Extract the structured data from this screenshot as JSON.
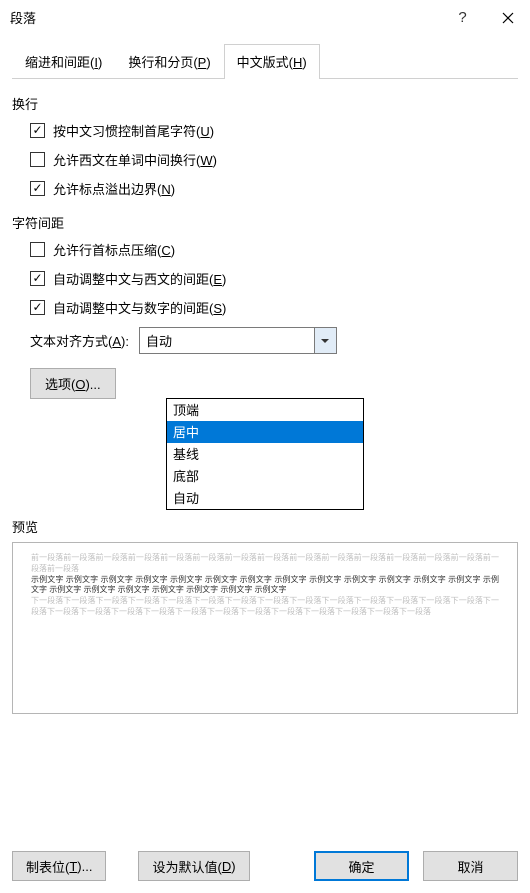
{
  "title": "段落",
  "tabs": {
    "t0": {
      "pre": "缩进和间距(",
      "key": "I",
      "post": ")"
    },
    "t1": {
      "pre": "换行和分页(",
      "key": "P",
      "post": ")"
    },
    "t2": {
      "pre": "中文版式(",
      "key": "H",
      "post": ")"
    }
  },
  "group1": {
    "label": "换行",
    "c0": {
      "pre": "按中文习惯控制首尾字符(",
      "key": "U",
      "post": ")",
      "checked": true
    },
    "c1": {
      "pre": "允许西文在单词中间换行(",
      "key": "W",
      "post": ")",
      "checked": false
    },
    "c2": {
      "pre": "允许标点溢出边界(",
      "key": "N",
      "post": ")",
      "checked": true
    }
  },
  "group2": {
    "label": "字符间距",
    "c0": {
      "pre": "允许行首标点压缩(",
      "key": "C",
      "post": ")",
      "checked": false
    },
    "c1": {
      "pre": "自动调整中文与西文的间距(",
      "key": "E",
      "post": ")",
      "checked": true
    },
    "c2": {
      "pre": "自动调整中文与数字的间距(",
      "key": "S",
      "post": ")",
      "checked": true
    }
  },
  "align": {
    "label_pre": "文本对齐方式(",
    "label_key": "A",
    "label_post": "):",
    "value": "自动",
    "options": {
      "o0": "顶端",
      "o1": "居中",
      "o2": "基线",
      "o3": "底部",
      "o4": "自动"
    }
  },
  "options_btn": {
    "pre": "选项(",
    "key": "O",
    "post": ")..."
  },
  "preview": {
    "label": "预览",
    "light1": "前一段落前一段落前一段落前一段落前一段落前一段落前一段落前一段落前一段落前一段落前一段落前一段落前一段落前一段落前一段落前一段落",
    "dark": "示例文字 示例文字 示例文字 示例文字 示例文字 示例文字 示例文字 示例文字 示例文字 示例文字 示例文字 示例文字 示例文字 示例文字 示例文字 示例文字 示例文字 示例文字 示例文字 示例文字 示例文字",
    "light2": "下一段落下一段落下一段落下一段落下一段落下一段落下一段落下一段落下一段落下一段落下一段落下一段落下一段落下一段落下一段落下一段落下一段落下一段落下一段落下一段落下一段落下一段落下一段落下一段落下一段落下一段落下一段落"
  },
  "footer": {
    "tabs_btn": {
      "pre": "制表位(",
      "key": "T",
      "post": ")..."
    },
    "default_btn": {
      "pre": "设为默认值(",
      "key": "D",
      "post": ")"
    },
    "ok": "确定",
    "cancel": "取消"
  }
}
